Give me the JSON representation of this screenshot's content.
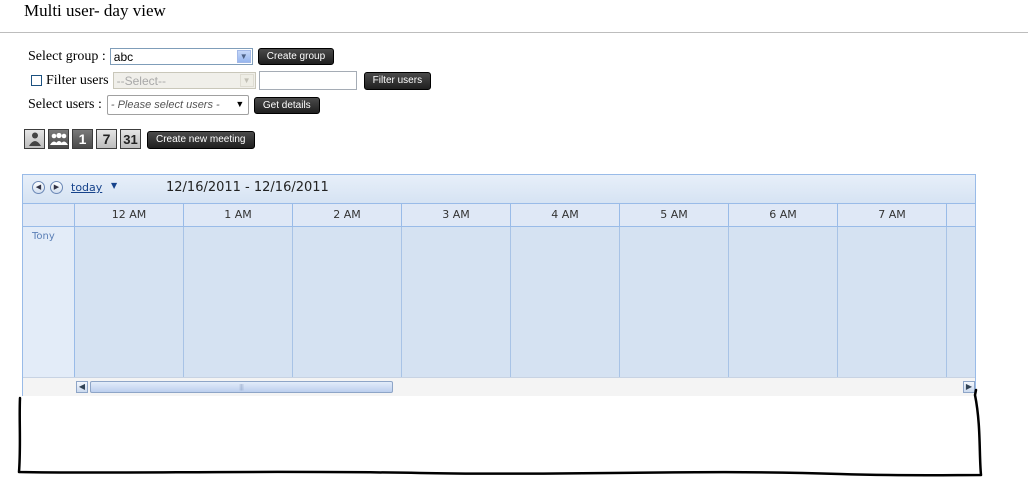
{
  "page": {
    "title": "Multi user- day view"
  },
  "form": {
    "group_label": "Select group :",
    "group_value": "abc",
    "create_group_label": "Create group",
    "filter_users_label": "Filter users",
    "filter_select_value": "--Select--",
    "filter_text_value": "",
    "filter_users_button": "Filter users",
    "select_users_label": "Select users :",
    "select_users_value": "- Please select users -",
    "get_details_label": "Get details"
  },
  "view_icons": [
    {
      "name": "single-user-view-icon"
    },
    {
      "name": "multi-user-view-icon"
    },
    {
      "name": "day-view-icon",
      "text": "1"
    },
    {
      "name": "week-view-icon",
      "text": "7"
    },
    {
      "name": "month-view-icon",
      "text": "31"
    }
  ],
  "create_meeting_label": "Create new meeting",
  "scheduler": {
    "today_label": "today",
    "date_range": "12/16/2011 - 12/16/2011",
    "hours": [
      "12 AM",
      "1 AM",
      "2 AM",
      "3 AM",
      "4 AM",
      "5 AM",
      "6 AM",
      "7 AM",
      ""
    ],
    "users": [
      "Tony"
    ]
  },
  "colors": {
    "accent_border": "#99bbe8",
    "header_bg": "#dfe8f6",
    "slot_bg": "#d5e2f2",
    "user_text": "#5b7fb6",
    "button_bg": "#2b2b2b"
  }
}
